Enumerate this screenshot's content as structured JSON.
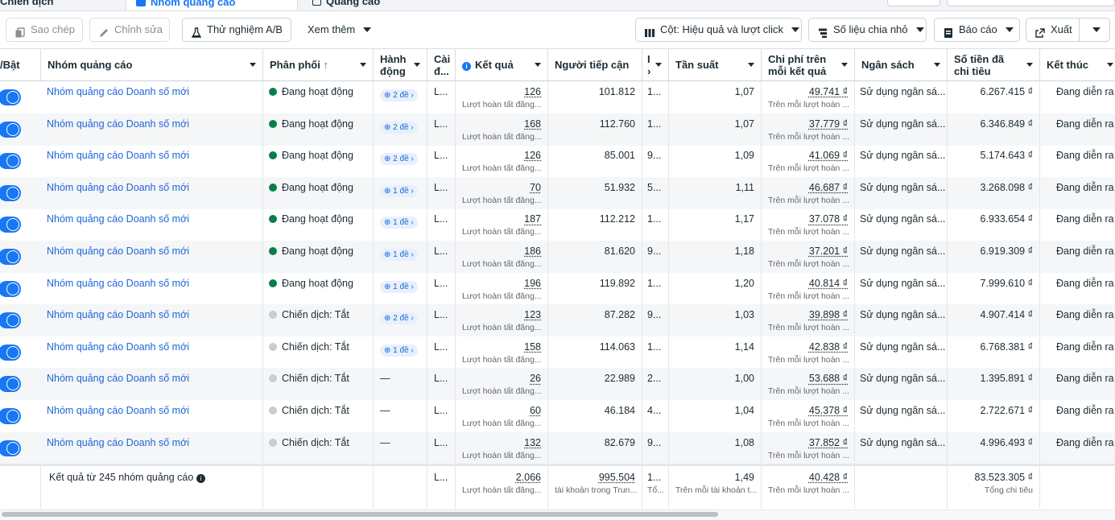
{
  "tabs": [
    {
      "label": "Chiến dịch"
    },
    {
      "label": "Nhóm quảng cáo"
    },
    {
      "label": "Quảng cáo"
    }
  ],
  "toolbar": {
    "copy_label": "Sao chép",
    "edit_label": "Chỉnh sửa",
    "ab_label": "Thử nghiệm A/B",
    "more_label": "Xem thêm",
    "columns_label": "Cột: Hiệu quả và lượt click",
    "breakdown_label": "Số liệu chia nhỏ",
    "report_label": "Báo cáo",
    "export_label": "Xuất"
  },
  "headers": {
    "toggle": "/Bật",
    "name": "Nhóm quảng cáo",
    "delivery": "Phân phối",
    "actions": "Hành động",
    "settings": "Cài đ...",
    "results": "Kết quả",
    "reach": "Người tiếp cận",
    "imp": "I ›",
    "frequency": "Tần suất",
    "cpr": "Chi phí trên mỗi kết quả",
    "budget": "Ngân sách",
    "spent": "Số tiền đã chi tiêu",
    "end": "Kết thúc"
  },
  "rows": [
    {
      "name": "Nhóm quảng cáo Doanh số mới",
      "status": "Đang hoạt động",
      "active": true,
      "action": "2 đề",
      "setting": "L...",
      "result": "126",
      "result_sub": "Lượt hoàn tất đăng...",
      "reach": "101.812",
      "imp": "1...",
      "freq": "1,07",
      "cpr": "49.741 ₫",
      "cpr_sub": "Trên mỗi lượt hoàn ...",
      "budget": "Sử dụng ngân sá...",
      "spent": "6.267.415 ₫",
      "end": "Đang diễn ra"
    },
    {
      "name": "Nhóm quảng cáo Doanh số mới",
      "status": "Đang hoạt động",
      "active": true,
      "action": "2 đề",
      "setting": "L...",
      "result": "168",
      "result_sub": "Lượt hoàn tất đăng...",
      "reach": "112.760",
      "imp": "1...",
      "freq": "1,07",
      "cpr": "37.779 ₫",
      "cpr_sub": "Trên mỗi lượt hoàn ...",
      "budget": "Sử dụng ngân sá...",
      "spent": "6.346.849 ₫",
      "end": "Đang diễn ra"
    },
    {
      "name": "Nhóm quảng cáo Doanh số mới",
      "status": "Đang hoạt động",
      "active": true,
      "action": "2 đề",
      "setting": "L...",
      "result": "126",
      "result_sub": "Lượt hoàn tất đăng...",
      "reach": "85.001",
      "imp": "9...",
      "freq": "1,09",
      "cpr": "41.069 ₫",
      "cpr_sub": "Trên mỗi lượt hoàn ...",
      "budget": "Sử dụng ngân sá...",
      "spent": "5.174.643 ₫",
      "end": "Đang diễn ra"
    },
    {
      "name": "Nhóm quảng cáo Doanh số mới",
      "status": "Đang hoạt động",
      "active": true,
      "action": "1 đề",
      "setting": "L...",
      "result": "70",
      "result_sub": "Lượt hoàn tất đăng...",
      "reach": "51.932",
      "imp": "5...",
      "freq": "1,11",
      "cpr": "46.687 ₫",
      "cpr_sub": "Trên mỗi lượt hoàn ...",
      "budget": "Sử dụng ngân sá...",
      "spent": "3.268.098 ₫",
      "end": "Đang diễn ra"
    },
    {
      "name": "Nhóm quảng cáo Doanh số mới",
      "status": "Đang hoạt động",
      "active": true,
      "action": "1 đề",
      "setting": "L...",
      "result": "187",
      "result_sub": "Lượt hoàn tất đăng...",
      "reach": "112.212",
      "imp": "1...",
      "freq": "1,17",
      "cpr": "37.078 ₫",
      "cpr_sub": "Trên mỗi lượt hoàn ...",
      "budget": "Sử dụng ngân sá...",
      "spent": "6.933.654 ₫",
      "end": "Đang diễn ra"
    },
    {
      "name": "Nhóm quảng cáo Doanh số mới",
      "status": "Đang hoạt động",
      "active": true,
      "action": "1 đề",
      "setting": "L...",
      "result": "186",
      "result_sub": "Lượt hoàn tất đăng...",
      "reach": "81.620",
      "imp": "9...",
      "freq": "1,18",
      "cpr": "37.201 ₫",
      "cpr_sub": "Trên mỗi lượt hoàn ...",
      "budget": "Sử dụng ngân sá...",
      "spent": "6.919.309 ₫",
      "end": "Đang diễn ra"
    },
    {
      "name": "Nhóm quảng cáo Doanh số mới",
      "status": "Đang hoạt động",
      "active": true,
      "action": "1 đề",
      "setting": "L...",
      "result": "196",
      "result_sub": "Lượt hoàn tất đăng...",
      "reach": "119.892",
      "imp": "1...",
      "freq": "1,20",
      "cpr": "40.814 ₫",
      "cpr_sub": "Trên mỗi lượt hoàn ...",
      "budget": "Sử dụng ngân sá...",
      "spent": "7.999.610 ₫",
      "end": "Đang diễn ra"
    },
    {
      "name": "Nhóm quảng cáo Doanh số mới",
      "status": "Chiến dịch: Tắt",
      "active": false,
      "action": "2 đề",
      "setting": "L...",
      "result": "123",
      "result_sub": "Lượt hoàn tất đăng...",
      "reach": "87.282",
      "imp": "9...",
      "freq": "1,03",
      "cpr": "39.898 ₫",
      "cpr_sub": "Trên mỗi lượt hoàn ...",
      "budget": "Sử dụng ngân sá...",
      "spent": "4.907.414 ₫",
      "end": "Đang diễn ra"
    },
    {
      "name": "Nhóm quảng cáo Doanh số mới",
      "status": "Chiến dịch: Tắt",
      "active": false,
      "action": "1 đề",
      "setting": "L...",
      "result": "158",
      "result_sub": "Lượt hoàn tất đăng...",
      "reach": "114.063",
      "imp": "1...",
      "freq": "1,14",
      "cpr": "42.838 ₫",
      "cpr_sub": "Trên mỗi lượt hoàn ...",
      "budget": "Sử dụng ngân sá...",
      "spent": "6.768.381 ₫",
      "end": "Đang diễn ra"
    },
    {
      "name": "Nhóm quảng cáo Doanh số mới",
      "status": "Chiến dịch: Tắt",
      "active": false,
      "action": "—",
      "setting": "L...",
      "result": "26",
      "result_sub": "Lượt hoàn tất đăng...",
      "reach": "22.989",
      "imp": "2...",
      "freq": "1,00",
      "cpr": "53.688 ₫",
      "cpr_sub": "Trên mỗi lượt hoàn ...",
      "budget": "Sử dụng ngân sá...",
      "spent": "1.395.891 ₫",
      "end": "Đang diễn ra"
    },
    {
      "name": "Nhóm quảng cáo Doanh số mới",
      "status": "Chiến dịch: Tắt",
      "active": false,
      "action": "—",
      "setting": "L...",
      "result": "60",
      "result_sub": "Lượt hoàn tất đăng...",
      "reach": "46.184",
      "imp": "4...",
      "freq": "1,04",
      "cpr": "45.378 ₫",
      "cpr_sub": "Trên mỗi lượt hoàn ...",
      "budget": "Sử dụng ngân sá...",
      "spent": "2.722.671 ₫",
      "end": "Đang diễn ra"
    },
    {
      "name": "Nhóm quảng cáo Doanh số mới",
      "status": "Chiến dịch: Tắt",
      "active": false,
      "action": "—",
      "setting": "L...",
      "result": "132",
      "result_sub": "Lượt hoàn tất đăng...",
      "reach": "82.679",
      "imp": "9...",
      "freq": "1,08",
      "cpr": "37.852 ₫",
      "cpr_sub": "Trên mỗi lượt hoàn ...",
      "budget": "Sử dụng ngân sá...",
      "spent": "4.996.493 ₫",
      "end": "Đang diễn ra"
    }
  ],
  "footer": {
    "label": "Kết quả từ 245 nhóm quảng cáo",
    "setting": "L...",
    "result": "2.066",
    "result_sub": "Lượt hoàn tất đăng...",
    "reach": "995.504",
    "reach_sub": "tài khoản trong Trun...",
    "imp": "1...",
    "imp_sub": "Tổ...",
    "freq": "1,49",
    "freq_sub": "Trên mỗi tài khoản t...",
    "cpr": "40.428 ₫",
    "cpr_sub": "Trên mỗi lượt hoàn ...",
    "spent": "83.523.305 ₫",
    "spent_sub": "Tổng chi tiêu"
  },
  "colors": {
    "active_dot": "#0a7e4a",
    "off_dot": "#c9ccd1",
    "link": "#1e65d8",
    "toggle": "#1877f2"
  }
}
